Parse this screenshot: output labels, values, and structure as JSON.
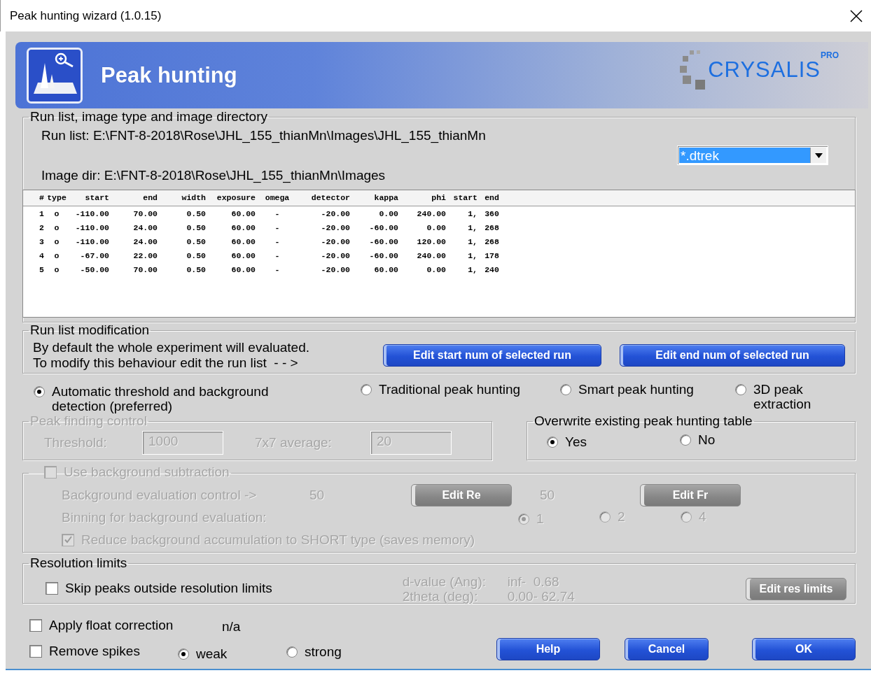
{
  "window": {
    "title": "Peak hunting wizard (1.0.15)"
  },
  "banner": {
    "title": "Peak hunting",
    "brand": "CRYSALIS",
    "brand_sup": "PRO"
  },
  "run_list_group": {
    "legend": "Run list, image type and image directory",
    "run_list": "Run list: E:\\FNT-8-2018\\Rose\\JHL_155_thianMn\\Images\\JHL_155_thianMn",
    "image_type": "*.dtrek",
    "image_dir": "Image dir: E:\\FNT-8-2018\\Rose\\JHL_155_thianMn\\Images"
  },
  "run_table": {
    "columns": [
      "#",
      "type",
      "start",
      "end",
      "width",
      "exposure",
      "omega",
      "detector",
      "kappa",
      "phi",
      "start",
      "end"
    ],
    "rows": [
      [
        "1",
        "o",
        "-110.00",
        "70.00",
        "0.50",
        "60.00",
        "-",
        "-20.00",
        "0.00",
        "240.00",
        "1,",
        "360"
      ],
      [
        "2",
        "o",
        "-110.00",
        "24.00",
        "0.50",
        "60.00",
        "-",
        "-20.00",
        "-60.00",
        "0.00",
        "1,",
        "268"
      ],
      [
        "3",
        "o",
        "-110.00",
        "24.00",
        "0.50",
        "60.00",
        "-",
        "-20.00",
        "-60.00",
        "120.00",
        "1,",
        "268"
      ],
      [
        "4",
        "o",
        "-67.00",
        "22.00",
        "0.50",
        "60.00",
        "-",
        "-20.00",
        "-60.00",
        "240.00",
        "1,",
        "178"
      ],
      [
        "5",
        "o",
        "-50.00",
        "70.00",
        "0.50",
        "60.00",
        "-",
        "-20.00",
        "60.00",
        "0.00",
        "1,",
        "240"
      ]
    ]
  },
  "run_list_modification": {
    "legend": "Run list modification",
    "lines": [
      "By default the whole experiment will evaluated.",
      "To modify this behaviour edit the run list  - - >"
    ],
    "buttons": [
      "Edit start num of selected run",
      "Edit end num of selected run"
    ]
  },
  "methods": [
    {
      "label": "Automatic threshold and background detection (preferred)",
      "selected": true
    },
    {
      "label": "Traditional peak hunting",
      "selected": false
    },
    {
      "label": "Smart peak hunting",
      "selected": false
    },
    {
      "label": "3D peak extraction",
      "selected": false
    }
  ],
  "peak_finding_control": {
    "legend": "Peak finding control",
    "disabled": true,
    "threshold_label": "Threshold:",
    "threshold": "1000",
    "average_label": "7x7 average:",
    "average": "20"
  },
  "overwrite_table": {
    "legend": "Overwrite existing peak hunting table",
    "options": [
      {
        "label": "Yes",
        "selected": true
      },
      {
        "label": "No",
        "selected": false
      }
    ]
  },
  "background": {
    "disabled": true,
    "use_subtraction": {
      "label": "Use background subtraction",
      "checked": false
    },
    "evaluation_label": "Background evaluation control ->",
    "value_1": "50",
    "button_1": "Edit Re",
    "value_2": "50",
    "button_2": "Edit Fr",
    "binning_label": "Binning for background evaluation:",
    "binning": [
      {
        "label": "1",
        "selected": true
      },
      {
        "label": "2",
        "selected": false
      },
      {
        "label": "4",
        "selected": false
      }
    ],
    "reduce": {
      "label": "Reduce background accumulation to SHORT type (saves memory)",
      "checked": true
    }
  },
  "resolution_limits": {
    "legend": "Resolution limits",
    "skip": {
      "label": "Skip peaks outside resolution limits",
      "checked": false
    },
    "disabled": true,
    "d_value_label": "d-value (Ang):",
    "d_value": "inf-  0.68",
    "two_theta_label": "2theta (deg):",
    "two_theta": "0.00- 62.74",
    "button": "Edit res limits"
  },
  "float_correction": {
    "label": "Apply float correction",
    "checked": false,
    "value": "n/a"
  },
  "remove_spikes": {
    "label": "Remove spikes",
    "checked": false,
    "options": [
      {
        "label": "weak",
        "selected": true
      },
      {
        "label": "strong",
        "selected": false
      }
    ]
  },
  "buttons": [
    "Help",
    "Cancel",
    "OK"
  ]
}
